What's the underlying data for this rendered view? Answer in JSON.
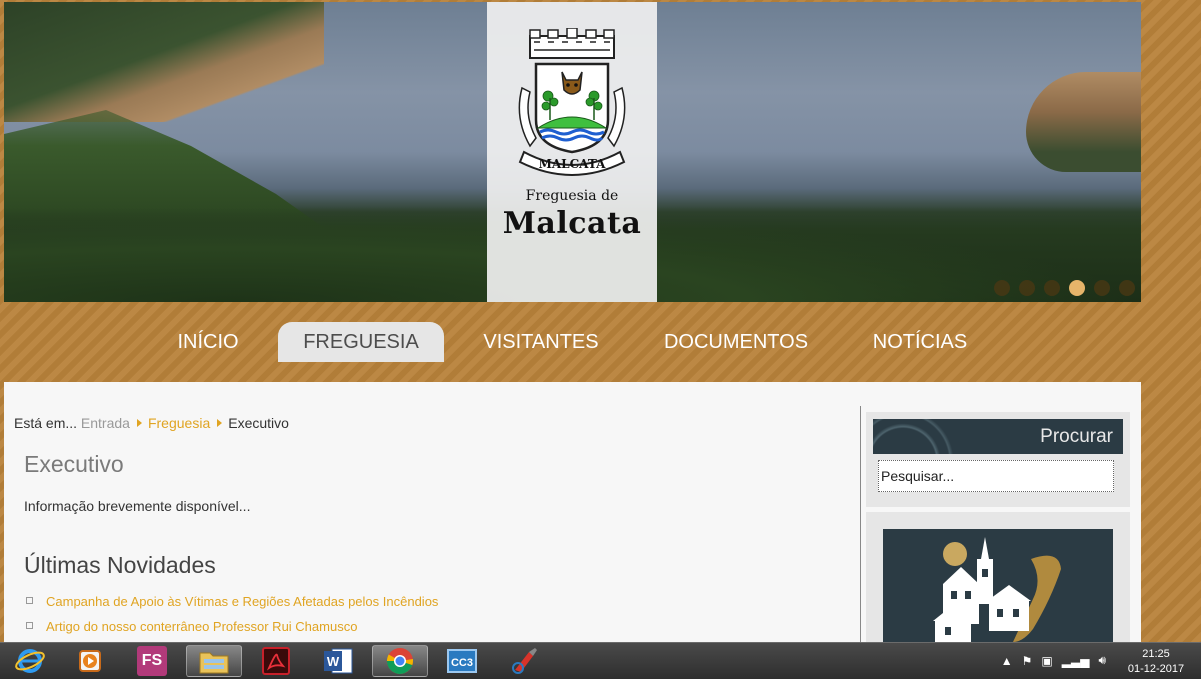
{
  "header": {
    "logo_subtitle": "Freguesia de",
    "logo_title": "Malcata",
    "crest_banner": "MALCATA",
    "slides": [
      false,
      false,
      false,
      true,
      false,
      false
    ]
  },
  "nav": {
    "items": [
      {
        "label": "INÍCIO"
      },
      {
        "label": "FREGUESIA"
      },
      {
        "label": "VISITANTES"
      },
      {
        "label": "DOCUMENTOS"
      },
      {
        "label": "NOTÍCIAS"
      }
    ],
    "active": "FREGUESIA"
  },
  "breadcrumb": {
    "prefix": "Está em...",
    "items": [
      "Entrada",
      "Freguesia",
      "Executivo"
    ]
  },
  "main": {
    "title": "Executivo",
    "info": "Informação brevemente disponível...",
    "news_title": "Últimas Novidades",
    "news": [
      "Campanha de Apoio às Vítimas e Regiões Afetadas pelos Incêndios",
      "Artigo do nosso conterrâneo Professor Rui Chamusco"
    ]
  },
  "sidebar": {
    "search_title": "Procurar",
    "search_value": "Pesquisar..."
  },
  "taskbar": {
    "apps": [
      "internet-explorer",
      "media-player",
      "fs-app",
      "file-explorer",
      "acrobat-reader",
      "word",
      "chrome",
      "cc3",
      "ccleaner"
    ],
    "time": "21:25",
    "date": "01-12-2017"
  },
  "colors": {
    "accent_gold": "#e0a422",
    "nav_bg": "#b8823a",
    "sidebar_head": "#2b3b44"
  }
}
